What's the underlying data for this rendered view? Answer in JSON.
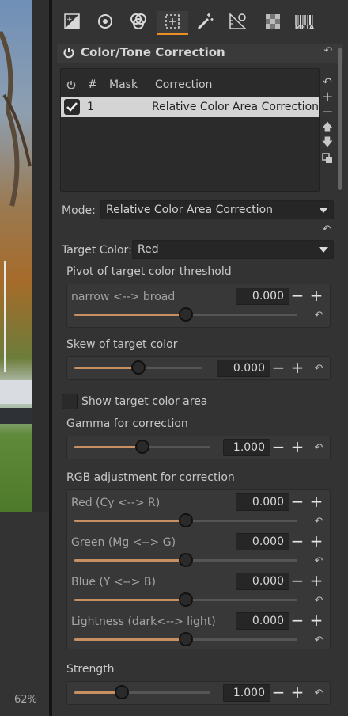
{
  "viewer": {
    "zoom": "62%"
  },
  "toolbar": {
    "tabs": [
      {
        "name": "tab-exposure",
        "icon": "exposure-icon"
      },
      {
        "name": "tab-detail",
        "icon": "detail-icon"
      },
      {
        "name": "tab-color",
        "icon": "color-circles-icon"
      },
      {
        "name": "tab-advanced",
        "icon": "advanced-icon"
      },
      {
        "name": "tab-transform",
        "icon": "magic-wand-icon"
      },
      {
        "name": "tab-lens",
        "icon": "lens-ruler-icon"
      },
      {
        "name": "tab-raw",
        "icon": "checkerboard-icon"
      },
      {
        "name": "tab-meta",
        "icon": "barcode-meta-icon",
        "label": "META"
      }
    ]
  },
  "tool": {
    "title": "Color/Tone Correction",
    "list_header": {
      "mask": "Mask",
      "correction": "Correction",
      "index": "#"
    },
    "rows": [
      {
        "index": "1",
        "correction": "Relative Color Area Correction",
        "enabled": true
      }
    ],
    "mode_label": "Mode:",
    "mode_value": "Relative Color Area Correction",
    "target_label": "Target Color:",
    "target_value": "Red",
    "pivot": {
      "title": "Pivot of target color threshold",
      "label": "narrow <--> broad",
      "value": "0.000",
      "position": 0.5
    },
    "skew": {
      "title": "Skew of target color",
      "value": "0.000",
      "position": 0.5
    },
    "show_area": {
      "label": "Show target color area",
      "checked": false
    },
    "gamma": {
      "title": "Gamma for correction",
      "value": "1.000",
      "position": 0.5
    },
    "rgb": {
      "title": "RGB adjustment for correction",
      "red": {
        "label": "Red (Cy <--> R)",
        "value": "0.000",
        "position": 0.5
      },
      "green": {
        "label": "Green (Mg <--> G)",
        "value": "0.000",
        "position": 0.5
      },
      "blue": {
        "label": "Blue  (Y <--> B)",
        "value": "0.000",
        "position": 0.5
      },
      "lightness": {
        "label": "Lightness (dark<--> light)",
        "value": "0.000",
        "position": 0.5
      }
    },
    "strength": {
      "title": "Strength",
      "value": "1.000",
      "position": 0.35
    }
  },
  "colors": {
    "accent": "#e88e25",
    "slider_fill": "#c89060",
    "panel_bg": "#333333"
  }
}
